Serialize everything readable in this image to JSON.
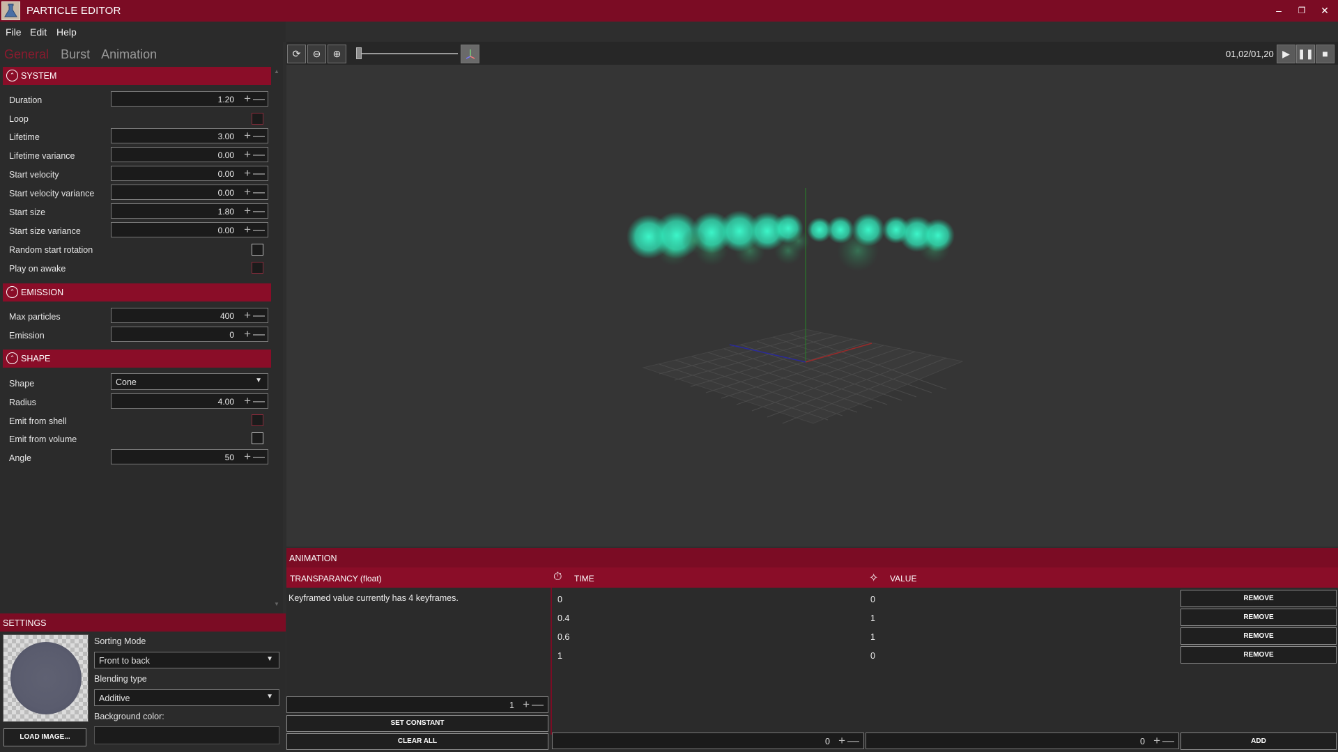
{
  "window": {
    "title": "PARTICLE EDITOR"
  },
  "menu": [
    "File",
    "Edit",
    "Help"
  ],
  "tabs": [
    "General",
    "Burst",
    "Animation"
  ],
  "sections": {
    "system": {
      "title": "SYSTEM",
      "duration": {
        "label": "Duration",
        "value": "1.20"
      },
      "loop": {
        "label": "Loop",
        "checked": false
      },
      "lifetime": {
        "label": "Lifetime",
        "value": "3.00"
      },
      "lifetime_variance": {
        "label": "Lifetime variance",
        "value": "0.00"
      },
      "start_velocity": {
        "label": "Start velocity",
        "value": "0.00"
      },
      "start_velocity_variance": {
        "label": "Start velocity variance",
        "value": "0.00"
      },
      "start_size": {
        "label": "Start size",
        "value": "1.80"
      },
      "start_size_variance": {
        "label": "Start size variance",
        "value": "0.00"
      },
      "random_start_rotation": {
        "label": "Random start rotation",
        "checked": false
      },
      "play_on_awake": {
        "label": "Play on awake",
        "checked": false
      }
    },
    "emission": {
      "title": "EMISSION",
      "max_particles": {
        "label": "Max particles",
        "value": "400"
      },
      "emission": {
        "label": "Emission",
        "value": "0"
      }
    },
    "shape": {
      "title": "SHAPE",
      "shape": {
        "label": "Shape",
        "value": "Cone"
      },
      "radius": {
        "label": "Radius",
        "value": "4.00"
      },
      "emit_from_shell": {
        "label": "Emit from shell",
        "checked": false
      },
      "emit_from_volume": {
        "label": "Emit from volume",
        "checked": false
      },
      "angle": {
        "label": "Angle",
        "value": "50"
      }
    }
  },
  "settings": {
    "title": "SETTINGS",
    "sorting_mode_label": "Sorting Mode",
    "sorting_mode": "Front to back",
    "blending_label": "Blending type",
    "blending": "Additive",
    "background_label": "Background color:",
    "load_image": "LOAD IMAGE..."
  },
  "viewport": {
    "frame_readout": "01,02/01,20",
    "zoom_slider_value": 0.02
  },
  "animation": {
    "title": "ANIMATION",
    "property": "TRANSPARANCY (float)",
    "time_header": "TIME",
    "value_header": "VALUE",
    "info": "Keyframed value currently has  4  keyframes.",
    "keyframes": [
      {
        "time": "0",
        "value": "0"
      },
      {
        "time": "0.4",
        "value": "1"
      },
      {
        "time": "0.6",
        "value": "1"
      },
      {
        "time": "1",
        "value": "0"
      }
    ],
    "remove_label": "REMOVE",
    "constant_value": "1",
    "set_constant": "SET CONSTANT",
    "clear_all": "CLEAR ALL",
    "new_time": "0",
    "new_value": "0",
    "add": "ADD"
  },
  "colors": {
    "accent": "#8a0d28",
    "titlebar": "#7b0c24",
    "particles": "#3dffd0"
  }
}
